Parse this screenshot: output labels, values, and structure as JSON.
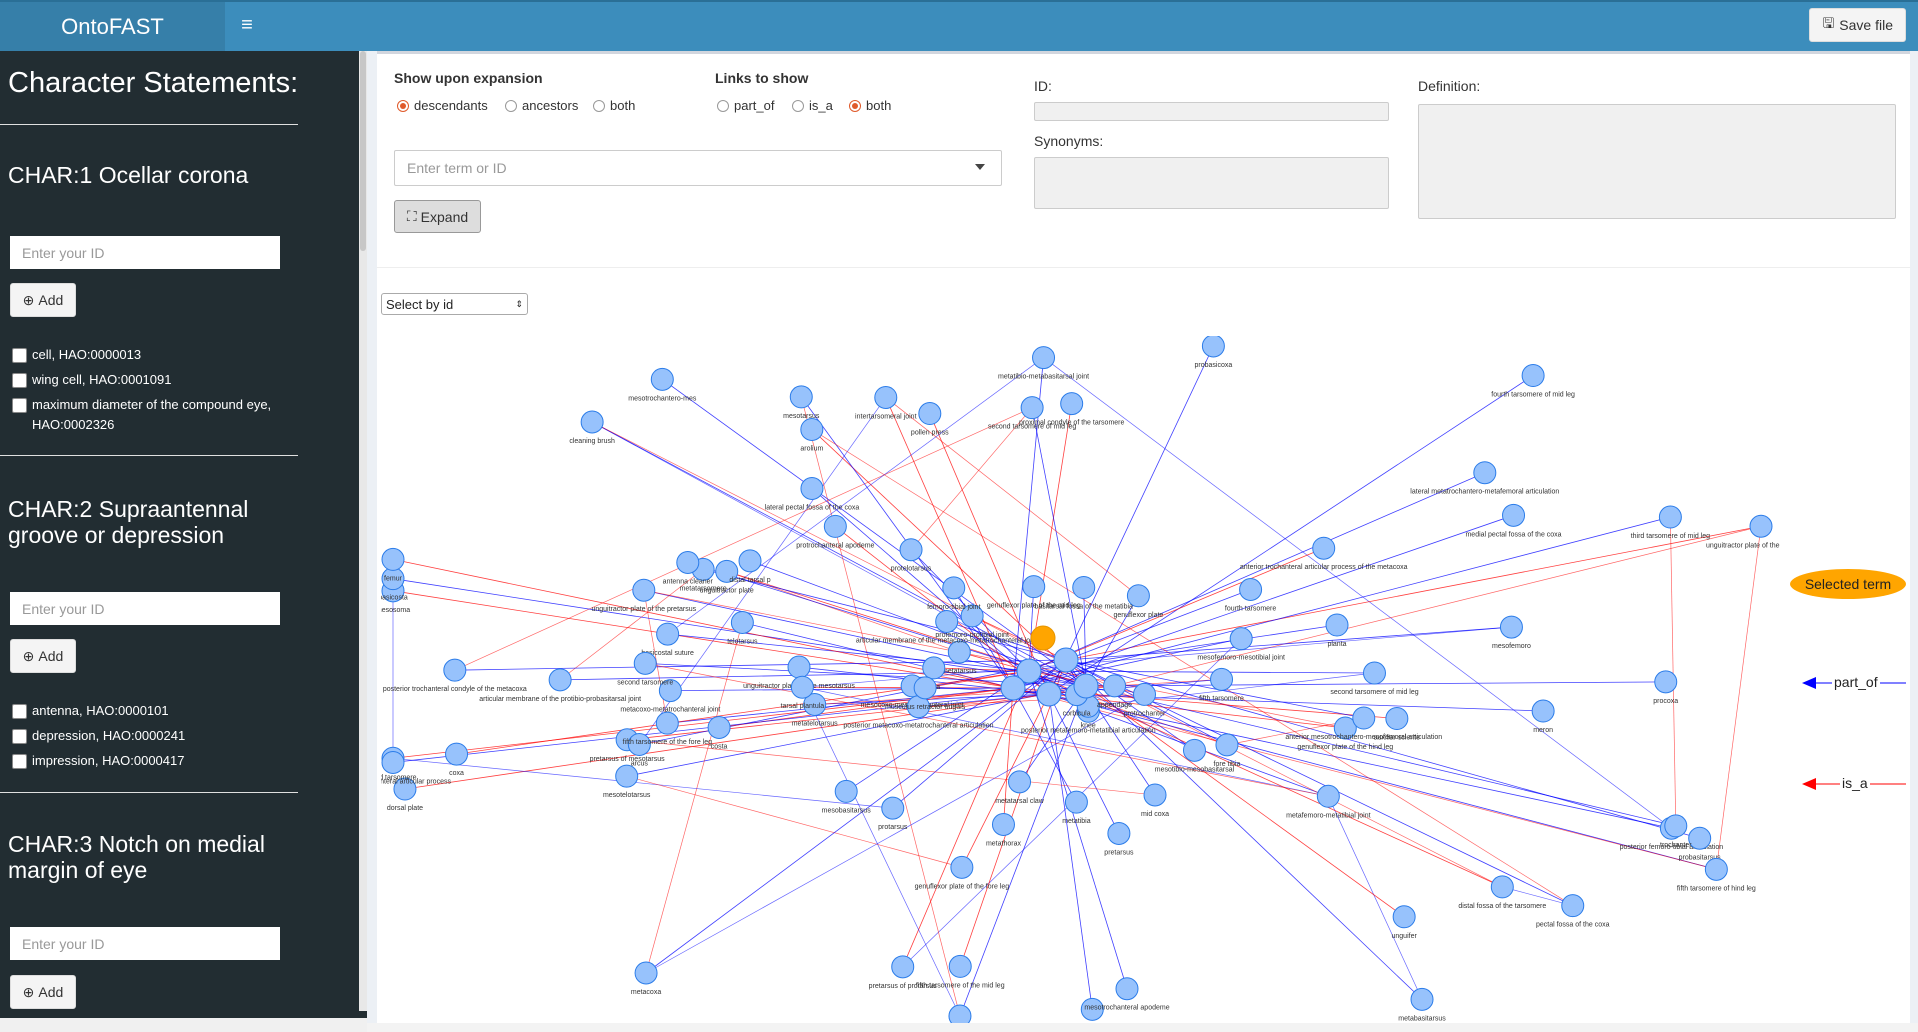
{
  "app": {
    "title": "OntoFAST",
    "save_label": "Save file"
  },
  "sidebar": {
    "title": "Character Statements:",
    "id_placeholder": "Enter your ID",
    "add_label": "Add",
    "characters": [
      {
        "title": "CHAR:1 Ocellar corona",
        "terms": [
          "cell, HAO:0000013",
          "wing cell, HAO:0001091",
          "maximum diameter of the compound eye, HAO:0002326"
        ]
      },
      {
        "title": "CHAR:2 Supraantennal groove or depression",
        "terms": [
          "antenna, HAO:0000101",
          "depression, HAO:0000241",
          "impression, HAO:0000417"
        ]
      },
      {
        "title": "CHAR:3 Notch on medial margin of eye",
        "terms": []
      }
    ]
  },
  "controls": {
    "expansion_label": "Show upon expansion",
    "expansion_options": [
      "descendants",
      "ancestors",
      "both"
    ],
    "expansion_selected": "descendants",
    "links_label": "Links to show",
    "links_options": [
      "part_of",
      "is_a",
      "both"
    ],
    "links_selected": "both",
    "term_placeholder": "Enter term or ID",
    "expand_label": "Expand",
    "id_label": "ID:",
    "synonyms_label": "Synonyms:",
    "definition_label": "Definition:",
    "select_by": "Select by id"
  },
  "legend": {
    "selected": "Selected term",
    "part_of": "part_of",
    "is_a": "is_a",
    "part_of_color": "#0000ff",
    "is_a_color": "#ff0000",
    "node_color": "#97c2fc",
    "selected_color": "#ffa500"
  },
  "graph": {
    "labels": [
      "articular membrane of the protibio-probasitarsal joint",
      "fore tibia",
      "pretarsus of mesotarsus",
      "posterior femoro-tibial articulation",
      "unguitractor plate",
      "pretarsus of protarsus",
      "profemoro-protibial joint",
      "unguitractor plate of the mesotarsus",
      "femoro-tibial joint",
      "unguitractor plate of the pretarsus",
      "posterior metafemoro-metatibial articulation",
      "unguitractor plate of the metatarsus",
      "metafemoro-metatibial joint",
      "mesofemoro-mesotibial joint",
      "mesotelotarsus",
      "protelotarsus",
      "metabasitarsus",
      "metatelotarsus",
      "telotarsus",
      "unguifer",
      "mesobasitarsus",
      "probasitarsus",
      "basitarsus",
      "tarsal plantula",
      "distal tarsal p",
      "proximal condyle of the tarsomere",
      "mesotibio-mesobasitarsal",
      "mesocoxo-mesotrochanteral joint",
      "auxiliar sclerite",
      "arolium",
      "planta",
      "arcus",
      "dorsal plate",
      "fifth tarsomere of the fore leg",
      "metatarsal claw",
      "genuflexor plate of the mid leg",
      "fifth tarsomere of the mid leg",
      "fourth tarsomere of mid leg",
      "third tarsomere of mid leg",
      "second tarsomere of mid leg",
      "metatarsus",
      "protarsus",
      "pretarsus",
      "mesotarsus",
      "tarsus",
      "second tarsomere of mid leg",
      "metatarsomere",
      "fifth tarsomere of hind leg",
      "third tarsomere",
      "antenna cleaner",
      "distal fossa of the tarsomere",
      "fourth tarsomere",
      "fifth tarsomere",
      "intertarsomeral joint",
      "mesotrochantero-mes",
      "mesotrochanteral apodeme",
      "knee",
      "appendage",
      "mesosoma",
      "genuflexor plate",
      "tibia",
      "genuflexor plate of the fore leg",
      "genuflexor plate of the hind leg",
      "metatibia",
      "basitarsal fossa of the metatibia",
      "corbicula",
      "articular membrane of the metacoxo-metatrochanteral joint",
      "posterior metacoxo-metatrochanteral articulation",
      "metacoxo-metatrochanteral joint",
      "procoxa",
      "coxa",
      "metacoxa",
      "pollen press",
      "metathorax",
      "trochanter",
      "protrochanter",
      "mid coxa",
      "meron",
      "costa",
      "basicosta",
      "basicostal suture",
      "pectal fossa of the coxa",
      "lateral pectal fossa of the coxa",
      "medial pectal fossa of the coxa",
      "anterior trochanteral articular process",
      "anterior trochanteral articular process of the metacoxa",
      "posterior trochanteral condyle of the metacoxa",
      "probasicoxa",
      "femur",
      "cleaning brush",
      "musculus retractor unguis",
      "mesofemoro",
      "protrochanteral apodeme",
      "metatibio-metabasitarsal joint",
      "second tarsomere",
      "lateral metatrochantero-metafemoral articulation",
      "anterior mesotrochantero-mesofemoral articulation"
    ]
  }
}
